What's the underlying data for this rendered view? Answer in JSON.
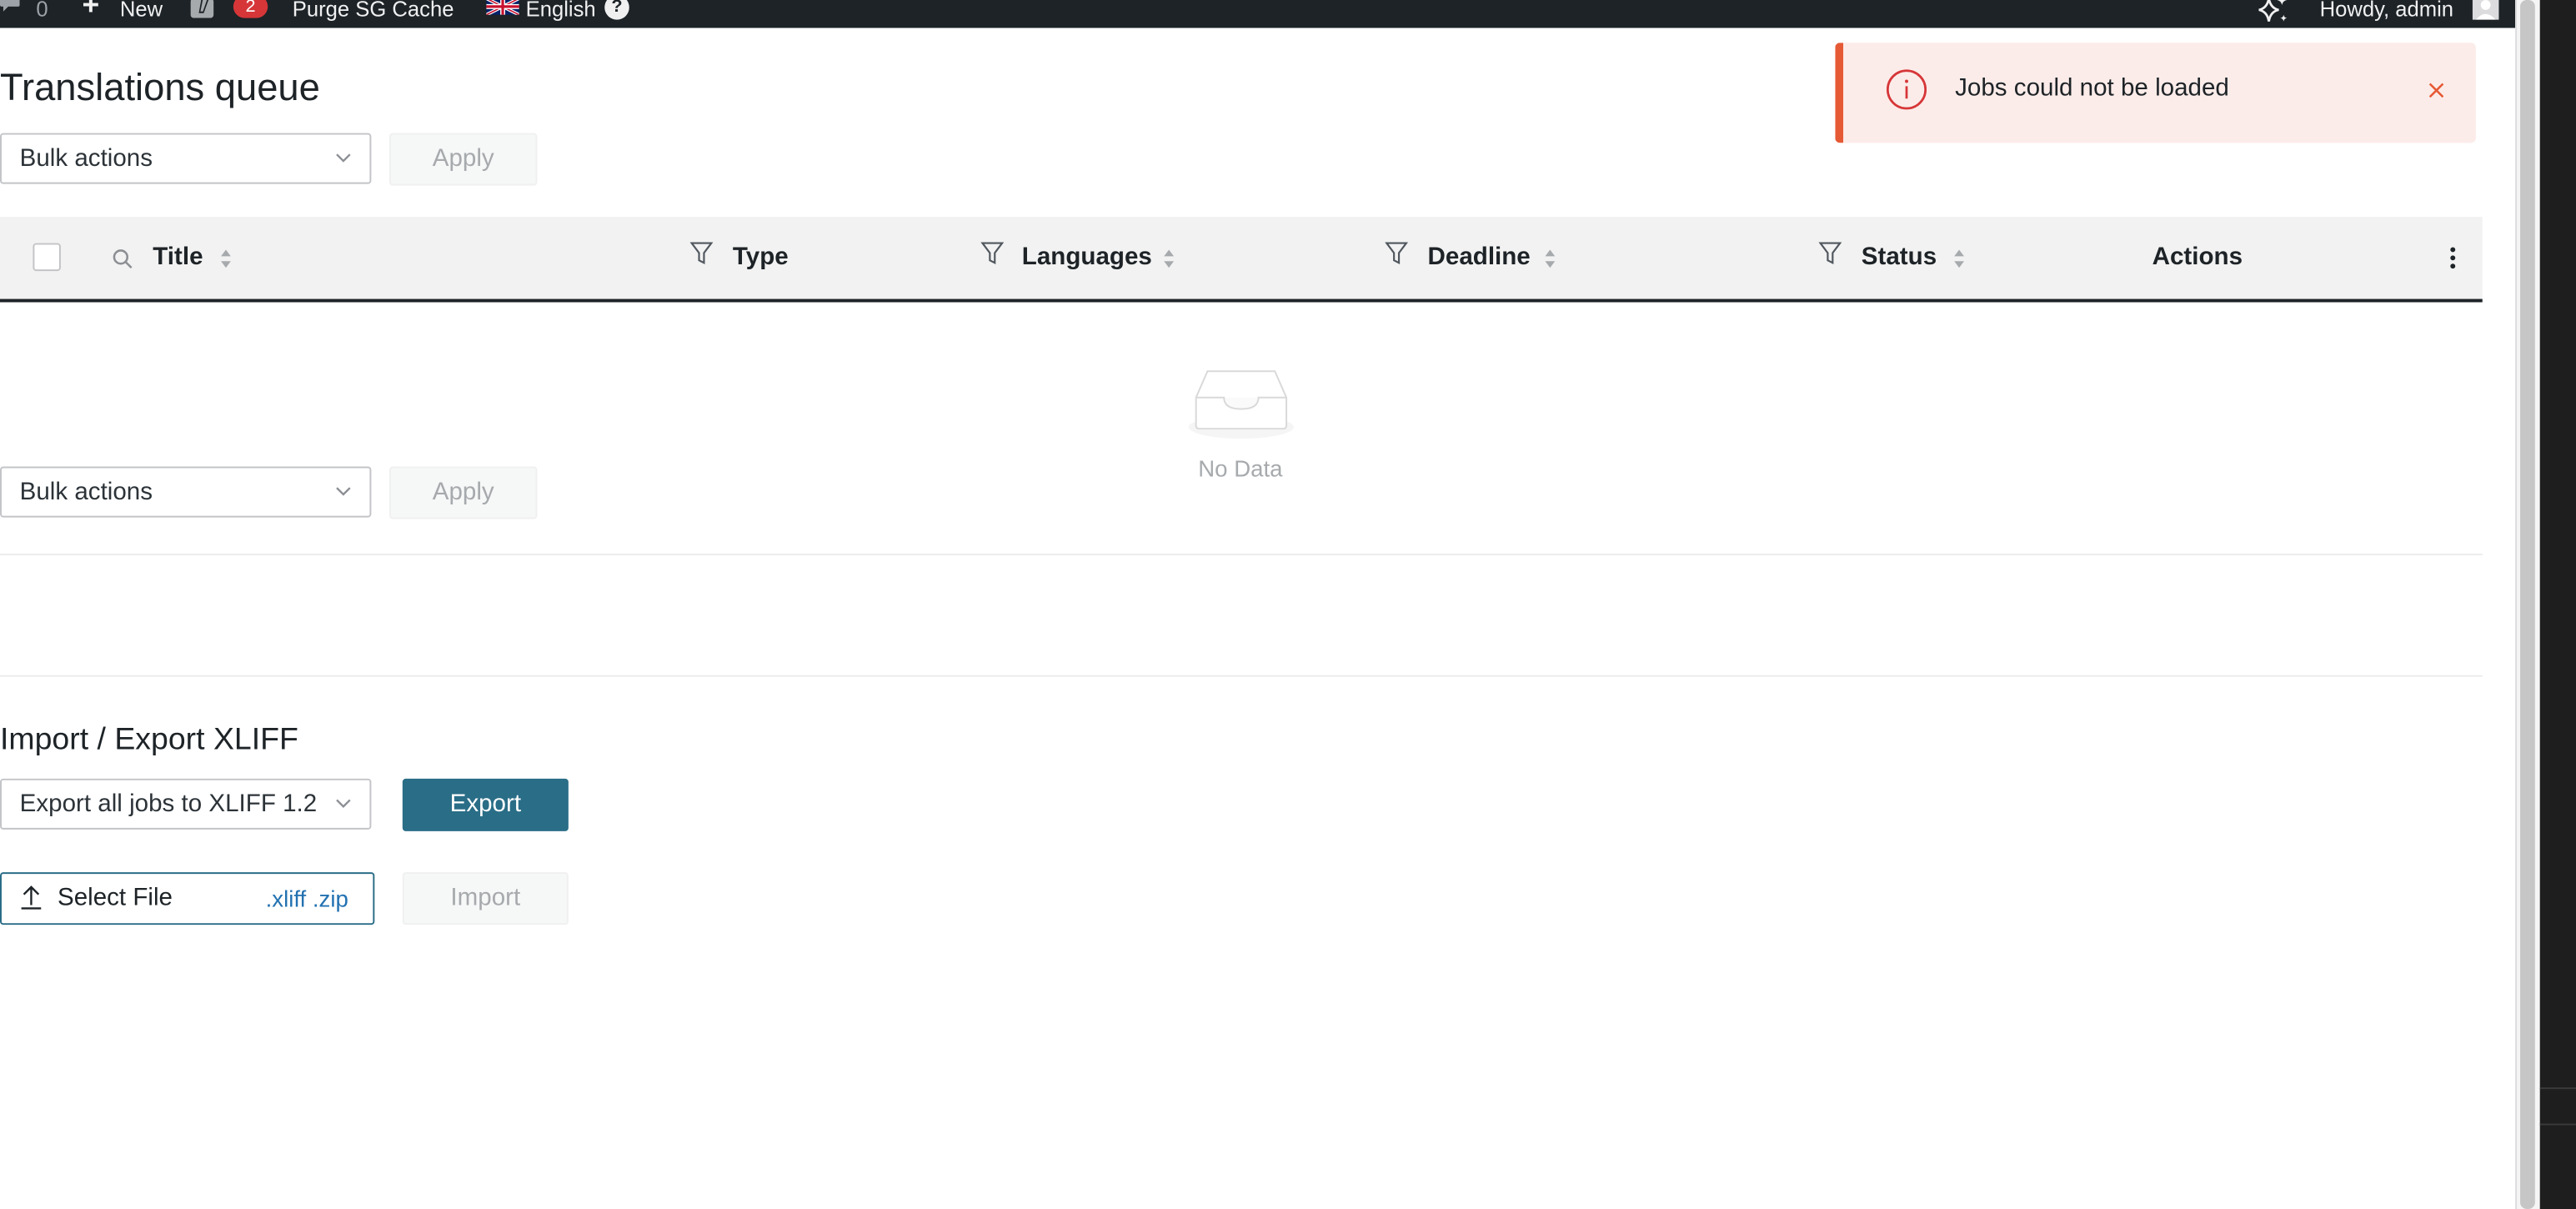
{
  "adminbar": {
    "comment_count": "0",
    "new_label": "New",
    "plus_glyph": "+",
    "updates_badge": "2",
    "purge_label": "Purge SG Cache",
    "language_label": "English",
    "help_glyph": "?",
    "howdy_label": "Howdy, admin",
    "icons": [
      "comment-icon",
      "plus-icon",
      "yoast-icon",
      "uk-flag-icon",
      "help-icon",
      "sparkle-icon",
      "avatar"
    ]
  },
  "page": {
    "title": "Translations queue"
  },
  "bulk_top": {
    "select_value": "Bulk actions",
    "apply_label": "Apply"
  },
  "table": {
    "columns": {
      "title": "Title",
      "type": "Type",
      "languages": "Languages",
      "deadline": "Deadline",
      "status": "Status",
      "actions": "Actions"
    },
    "empty_text": "No Data"
  },
  "bulk_bottom": {
    "select_value": "Bulk actions",
    "apply_label": "Apply"
  },
  "xliff": {
    "section_title": "Import / Export XLIFF",
    "export_select_value": "Export all jobs to XLIFF 1.2",
    "export_label": "Export",
    "file_label": "Select File",
    "file_ext": ".xliff .zip",
    "import_label": "Import"
  },
  "notice": {
    "message": "Jobs could not be loaded"
  },
  "colors": {
    "adminbar_bg": "#1d2327",
    "primary": "#2a6d87",
    "error_accent": "#e65935",
    "error_bg": "#fcece9",
    "badge": "#d63638",
    "link": "#2271b1"
  }
}
